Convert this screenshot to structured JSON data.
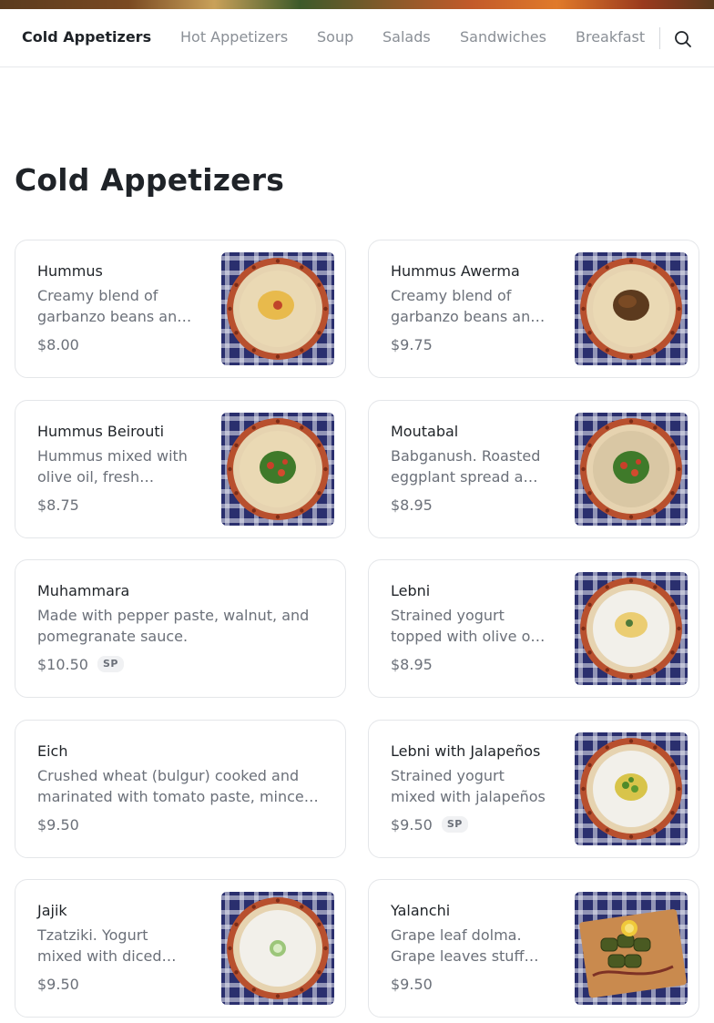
{
  "nav": {
    "tabs": [
      {
        "label": "Cold Appetizers",
        "active": true
      },
      {
        "label": "Hot Appetizers",
        "active": false
      },
      {
        "label": "Soup",
        "active": false
      },
      {
        "label": "Salads",
        "active": false
      },
      {
        "label": "Sandwiches",
        "active": false
      },
      {
        "label": "Breakfast",
        "active": false
      }
    ],
    "search_icon": "search-icon"
  },
  "section": {
    "title": "Cold Appetizers"
  },
  "items": [
    {
      "name": "Hummus",
      "description": "Creamy blend of garbanzo beans and tahini with olive oil",
      "price": "$8.00",
      "badge": null,
      "image": "hummus-plate",
      "image_topping": "olive-oil-paprika"
    },
    {
      "name": "Hummus Awerma",
      "description": "Creamy blend of garbanzo beans and tahini topped with awerma",
      "price": "$9.75",
      "badge": null,
      "image": "hummus-plate",
      "image_topping": "minced-meat"
    },
    {
      "name": "Hummus Beirouti",
      "description": "Hummus mixed with olive oil, fresh parsley, and tomatoes",
      "price": "$8.75",
      "badge": null,
      "image": "hummus-plate",
      "image_topping": "parsley-tomato"
    },
    {
      "name": "Moutabal",
      "description": "Babganush. Roasted eggplant spread and tahini",
      "price": "$8.95",
      "badge": null,
      "image": "eggplant-plate",
      "image_topping": "parsley-tomato"
    },
    {
      "name": "Muhammara",
      "description": "Made with pepper paste, walnut, and pomegranate sauce.",
      "price": "$10.50",
      "badge": "SP",
      "image": null
    },
    {
      "name": "Lebni",
      "description": "Strained yogurt topped with olive oil and mint",
      "price": "$8.95",
      "badge": null,
      "image": "yogurt-plate",
      "image_topping": "olive-oil-mint"
    },
    {
      "name": "Eich",
      "description": "Crushed wheat (bulgur) cooked and marinated with tomato paste, minced vegetables",
      "price": "$9.50",
      "badge": null,
      "image": null
    },
    {
      "name": "Lebni with Jalapeños",
      "description": "Strained yogurt mixed with jalapeños",
      "price": "$9.50",
      "badge": "SP",
      "image": "yogurt-plate",
      "image_topping": "jalapeno"
    },
    {
      "name": "Jajik",
      "description": "Tzatziki. Yogurt mixed with diced cucumber",
      "price": "$9.50",
      "badge": null,
      "image": "yogurt-plate",
      "image_topping": "cucumber"
    },
    {
      "name": "Yalanchi",
      "description": "Grape leaf dolma. Grape leaves stuffed with rice",
      "price": "$9.50",
      "badge": null,
      "image": "dolma-board",
      "image_topping": "lemon"
    }
  ]
}
